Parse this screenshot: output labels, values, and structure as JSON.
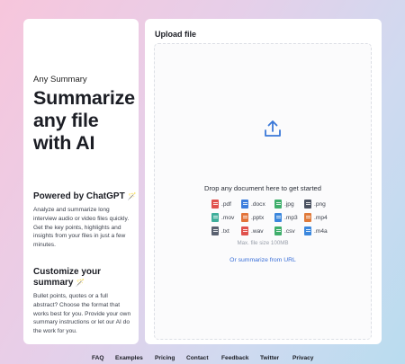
{
  "left": {
    "brand": "Any Summary",
    "hero": "Summarize any file with AI",
    "powered_title": "Powered by ChatGPT",
    "powered_emoji": "🪄",
    "powered_body": "Analyze and summarize long interview audio or video files quickly. Get the key points, highlights and insights from your files in just a few minutes.",
    "customize_title": "Customize your summary",
    "customize_emoji": "🪄",
    "customize_body": "Bullet points, quotes or a full abstract? Choose the format that works best for you. Provide your own summary instructions or let our AI do the work for you."
  },
  "upload": {
    "title": "Upload file",
    "drop_text": "Drop any document here to get started",
    "max_size": "Max. file size 100MB",
    "url_link": "Or summarize from URL",
    "file_types": [
      {
        "ext": ".pdf",
        "color": "#e0524d"
      },
      {
        "ext": ".docx",
        "color": "#3b7ddd"
      },
      {
        "ext": ".jpg",
        "color": "#3fae6b"
      },
      {
        "ext": ".png",
        "color": "#4a5160"
      },
      {
        "ext": ".mov",
        "color": "#3fae9b"
      },
      {
        "ext": ".pptx",
        "color": "#e2733a"
      },
      {
        "ext": ".mp3",
        "color": "#3b87dd"
      },
      {
        "ext": ".mp4",
        "color": "#e07a3a"
      },
      {
        "ext": ".txt",
        "color": "#5a6170"
      },
      {
        "ext": ".wav",
        "color": "#e0524d"
      },
      {
        "ext": ".csv",
        "color": "#3fae6b"
      },
      {
        "ext": ".m4a",
        "color": "#3b87dd"
      }
    ]
  },
  "footer": {
    "links": [
      "FAQ",
      "Examples",
      "Pricing",
      "Contact",
      "Feedback",
      "Twitter",
      "Privacy"
    ]
  },
  "colors": {
    "accent": "#3a6fd8",
    "upload_icon": "#3a78d8"
  }
}
